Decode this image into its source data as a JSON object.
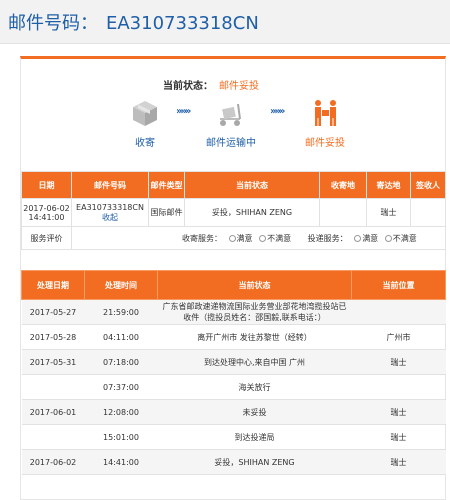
{
  "header": {
    "label": "邮件号码：",
    "mail_no": "EA310733318CN"
  },
  "status": {
    "label": "当前状态：",
    "value": "邮件妥投"
  },
  "steps": [
    {
      "label": "收寄",
      "icon": "package-box-icon",
      "active": false
    },
    {
      "label": "邮件运输中",
      "icon": "transport-cart-icon",
      "active": false
    },
    {
      "label": "邮件妥投",
      "icon": "delivery-person-icon",
      "active": true
    }
  ],
  "arrows": "»»»",
  "colors": {
    "accent": "#f26d21",
    "link": "#1f5fa8",
    "inactive_icon": "#bdbdbd"
  },
  "summary_table": {
    "headers": [
      "日期",
      "邮件号码",
      "邮件类型",
      "当前状态",
      "收寄地",
      "寄达地",
      "签收人"
    ],
    "row": {
      "date": "2017-06-02 14:41:00",
      "mail_no": "EA310733318CN",
      "details_link": "收起",
      "mail_type": "国际邮件",
      "status": "妥投，SHIHAN ZENG",
      "origin": "",
      "destination": "瑞士",
      "signee": ""
    },
    "evaluation": {
      "label": "服务评价",
      "pickup_label": "收寄服务：",
      "delivery_label": "投递服务：",
      "satisfied": "满意",
      "unsatisfied": "不满意"
    }
  },
  "track_table": {
    "headers": [
      "处理日期",
      "处理时间",
      "当前状态",
      "当前位置"
    ],
    "rows": [
      {
        "date": "2017-05-27",
        "time": "21:59:00",
        "status": "广东省邮政速递物流国际业务营业部花地湾揽投站已收件（揽投员姓名：邵国毅,联系电话：）",
        "location": ""
      },
      {
        "date": "2017-05-28",
        "time": "04:11:00",
        "status": "离开广州市 发往苏黎世（经转）",
        "location": "广州市"
      },
      {
        "date": "2017-05-31",
        "time": "07:18:00",
        "status": "到达处理中心,来自中国 广州",
        "location": "瑞士"
      },
      {
        "date": "",
        "time": "07:37:00",
        "status": "海关放行",
        "location": ""
      },
      {
        "date": "2017-06-01",
        "time": "12:08:00",
        "status": "未妥投",
        "location": "瑞士"
      },
      {
        "date": "",
        "time": "15:01:00",
        "status": "到达投递局",
        "location": "瑞士"
      },
      {
        "date": "2017-06-02",
        "time": "14:41:00",
        "status": "妥投，SHIHAN ZENG",
        "location": "瑞士"
      }
    ]
  }
}
